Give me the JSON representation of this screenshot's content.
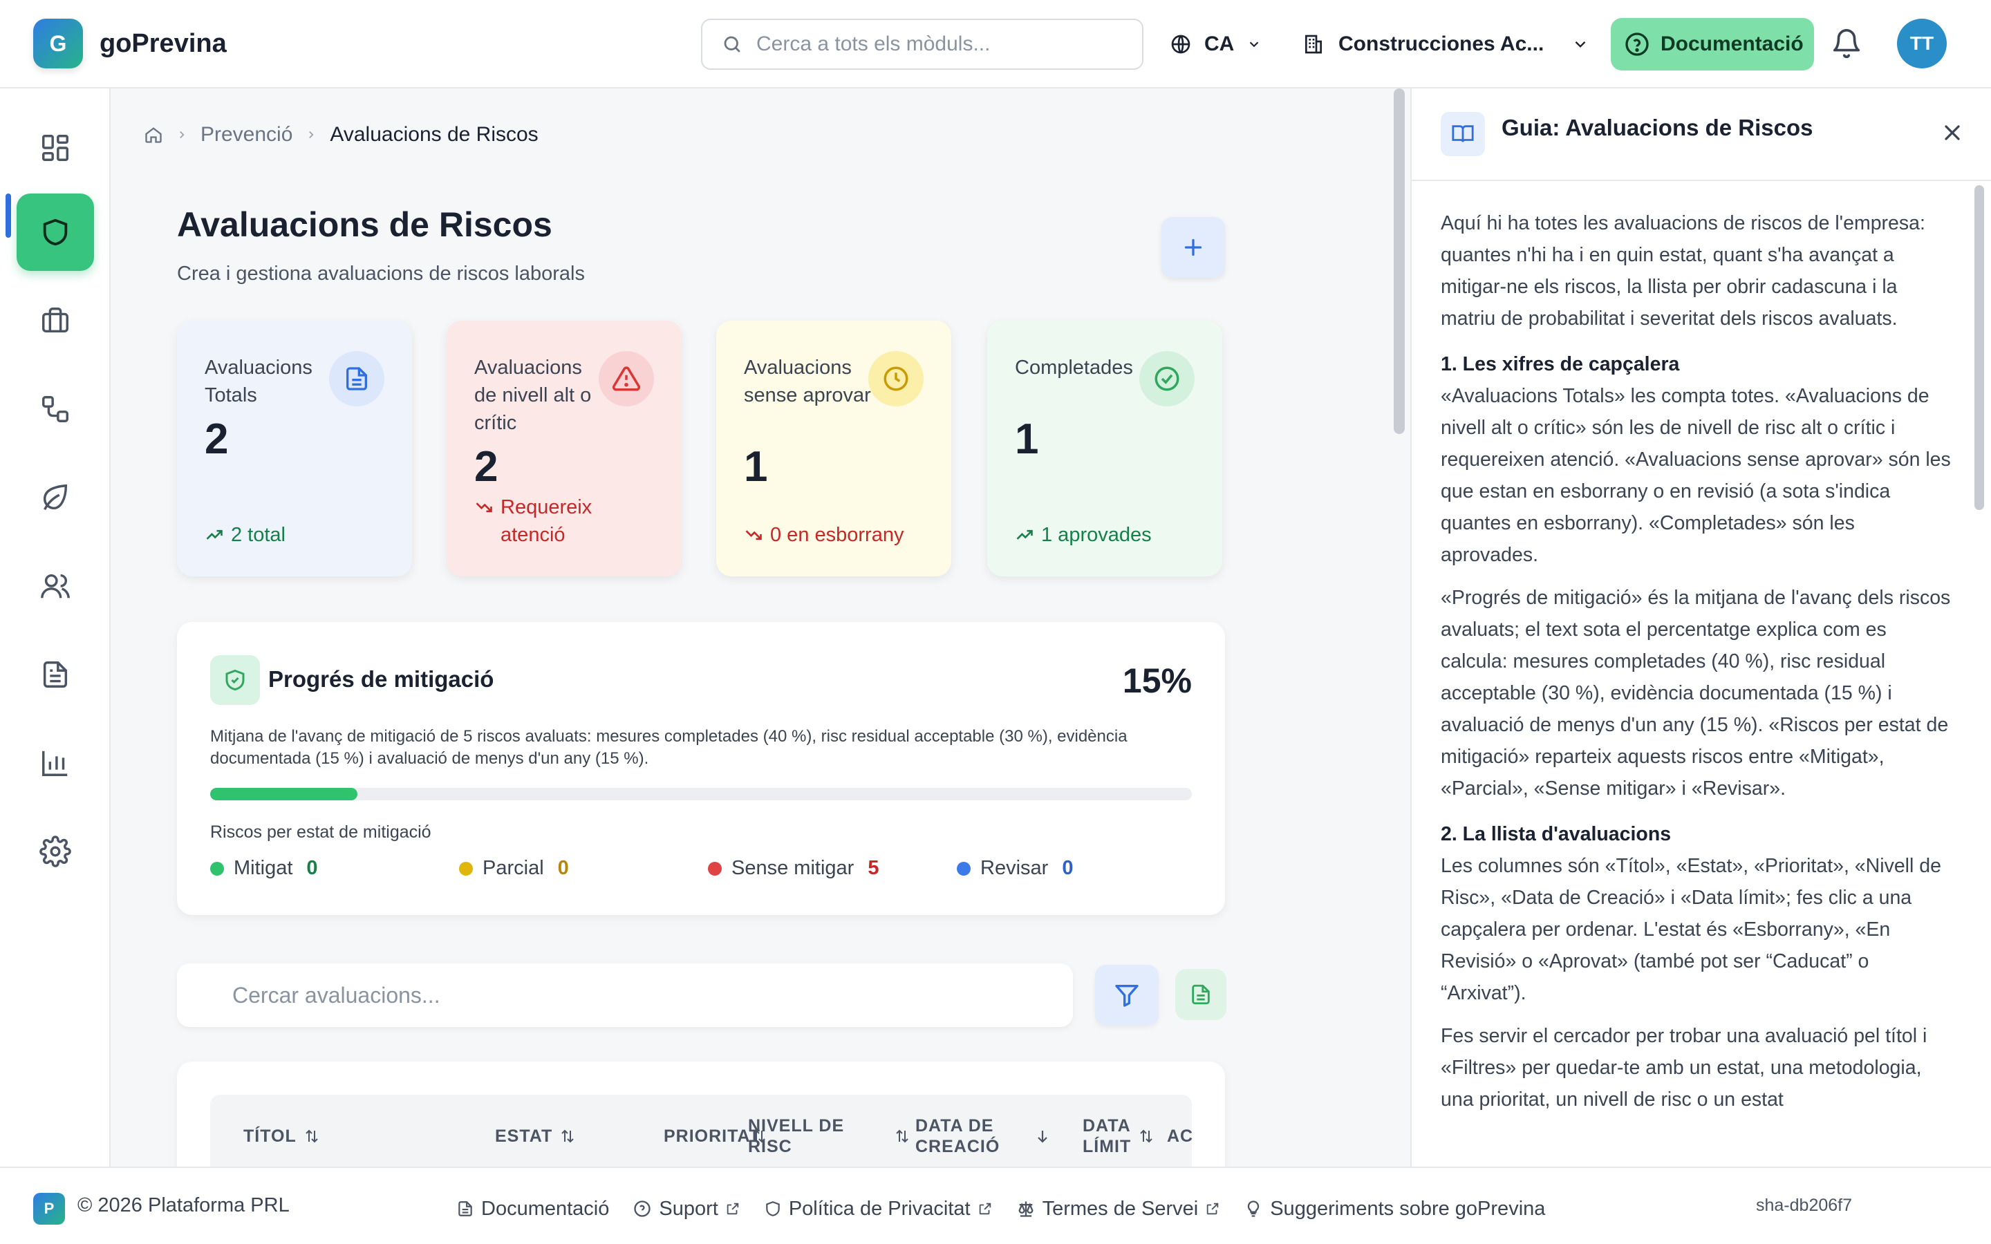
{
  "header": {
    "logo_letter": "G",
    "app_name": "goPrevina",
    "search_placeholder": "Cerca a tots els mòduls...",
    "language": "CA",
    "company": "Construcciones Ac...",
    "doc_button": "Documentació",
    "avatar_initials": "TT"
  },
  "sidebar": {
    "items": [
      {
        "icon": "dashboard-icon",
        "active": false
      },
      {
        "icon": "shield-icon",
        "active": true
      },
      {
        "icon": "briefcase-icon",
        "active": false
      },
      {
        "icon": "workflow-icon",
        "active": false
      },
      {
        "icon": "leaf-icon",
        "active": false
      },
      {
        "icon": "users-icon",
        "active": false
      },
      {
        "icon": "document-icon",
        "active": false
      },
      {
        "icon": "bar-chart-icon",
        "active": false
      },
      {
        "icon": "gear-icon",
        "active": false
      }
    ]
  },
  "breadcrumb": {
    "section": "Prevenció",
    "current": "Avaluacions de Riscos"
  },
  "page": {
    "title": "Avaluacions de Riscos",
    "subtitle": "Crea i gestiona avaluacions de riscos laborals"
  },
  "stats": [
    {
      "label": "Avaluacions Totals",
      "value": "2",
      "trend": "2 total",
      "bg": "#eef3fc",
      "accent": "#2f6fde",
      "trend_color": "#16804a"
    },
    {
      "label": "Avaluacions de nivell alt o crític",
      "value": "2",
      "trend": "Requereix atenció",
      "bg": "#fde8e8",
      "accent": "#d93636",
      "trend_color": "#c62828"
    },
    {
      "label": "Avaluacions sense aprovar",
      "value": "1",
      "trend": "0 en esborrany",
      "bg": "#fefbe6",
      "accent": "#d8a90a",
      "trend_color": "#c62828"
    },
    {
      "label": "Completades",
      "value": "1",
      "trend": "1 aprovades",
      "bg": "#eefaf1",
      "accent": "#2fa85e",
      "trend_color": "#16804a"
    }
  ],
  "progress": {
    "title": "Progrés de mitigació",
    "percent_label": "15%",
    "percent": 15,
    "description": "Mitjana de l'avanç de mitigació de 5 riscos avaluats: mesures completades (40 %), risc residual acceptable (30 %), evidència documentada (15 %) i avaluació de menys d'un any (15 %).",
    "legend_title": "Riscos per estat de mitigació",
    "legend": [
      {
        "label": "Mitigat",
        "count": "0",
        "color": "#2fc36e",
        "count_color": "#16804a"
      },
      {
        "label": "Parcial",
        "count": "0",
        "color": "#e0b60c",
        "count_color": "#b8860b"
      },
      {
        "label": "Sense mitigar",
        "count": "5",
        "color": "#e04343",
        "count_color": "#c62828"
      },
      {
        "label": "Revisar",
        "count": "0",
        "color": "#3b7ae8",
        "count_color": "#2f5fc8"
      }
    ]
  },
  "filters": {
    "search_placeholder": "Cercar avaluacions..."
  },
  "table": {
    "columns": {
      "title": "TÍTOL",
      "status": "ESTAT",
      "priority": "PRIORITAT",
      "risk_level_1": "NIVELL DE",
      "risk_level_2": "RISC",
      "created_1": "DATA DE",
      "created_2": "CREACIÓ",
      "deadline_1": "DATA",
      "deadline_2": "LÍMIT",
      "actions": "AC"
    }
  },
  "guide": {
    "title": "Guia: Avaluacions de Riscos",
    "intro": "Aquí hi ha totes les avaluacions de riscos de l'empresa: quantes n'hi ha i en quin estat, quant s'ha avançat a mitigar-ne els riscos, la llista per obrir cadascuna i la matriu de probabilitat i severitat dels riscos avaluats.",
    "h1": "1. Les xifres de capçalera",
    "p1": "«Avaluacions Totals» les compta totes. «Avaluacions de nivell alt o crític» són les de nivell de risc alt o crític i requereixen atenció. «Avaluacions sense aprovar» són les que estan en esborrany o en revisió (a sota s'indica quantes en esborrany). «Completades» són les aprovades.",
    "p2": "«Progrés de mitigació» és la mitjana de l'avanç dels riscos avaluats; el text sota el percentatge explica com es calcula: mesures completades (40 %), risc residual acceptable (30 %), evidència documentada (15 %) i avaluació de menys d'un any (15 %). «Riscos per estat de mitigació» reparteix aquests riscos entre «Mitigat», «Parcial», «Sense mitigar» i «Revisar».",
    "h2": "2. La llista d'avaluacions",
    "p3": "Les columnes són «Títol», «Estat», «Prioritat», «Nivell de Risc», «Data de Creació» i «Data límit»; fes clic a una capçalera per ordenar. L'estat és «Esborrany», «En Revisió» o «Aprovat» (també pot ser “Caducat” o “Arxivat”).",
    "p4": "Fes servir el cercador per trobar una avaluació pel títol i «Filtres» per quedar-te amb un estat, una metodologia, una prioritat, un nivell de risc o un estat"
  },
  "footer": {
    "logo_letter": "P",
    "copyright": "© 2026 Plataforma PRL",
    "links": {
      "documentation": "Documentació",
      "support": "Suport",
      "privacy": "Política de Privacitat",
      "terms": "Termes de Servei",
      "suggestions": "Suggeriments sobre goPrevina"
    },
    "sha": "sha-db206f7"
  }
}
